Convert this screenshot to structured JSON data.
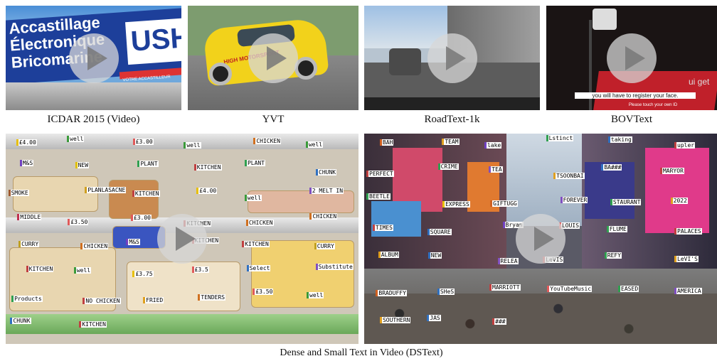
{
  "captions": {
    "icdar": "ICDAR 2015 (Video)",
    "yvt": "YVT",
    "roadtext": "RoadText-1k",
    "bovtext": "BOVText",
    "dstext": "Dense and Small Text in Video (DSText)"
  },
  "icdar_scene": {
    "sign_text": "Accastillage\nÉlectronique\nBricomarine",
    "brand": "USHI",
    "banner": "VOTRE ACCASTILLEUR QUOTIDIEN"
  },
  "yvt_scene": {
    "decal": "HIGH MOTORSPORT"
  },
  "bovtext_scene": {
    "screen_text": "you will have to register your face.",
    "screen_subtext": "Please touch your own ID",
    "light_text": "ui get"
  },
  "supermarket_labels": [
    {
      "t": "£4.00",
      "c": "#e8c000"
    },
    {
      "t": "well",
      "c": "#3a9a3a"
    },
    {
      "t": "£3.00",
      "c": "#e05a5a"
    },
    {
      "t": "well",
      "c": "#3a9a3a"
    },
    {
      "t": "CHICKEN",
      "c": "#d07020"
    },
    {
      "t": "well",
      "c": "#3a9a3a"
    },
    {
      "t": "M&S",
      "c": "#7040c0"
    },
    {
      "t": "NEW",
      "c": "#e0c000"
    },
    {
      "t": "PLANT",
      "c": "#30a050"
    },
    {
      "t": "KITCHEN",
      "c": "#c04040"
    },
    {
      "t": "PLANT",
      "c": "#30a050"
    },
    {
      "t": "CHUNK",
      "c": "#3070c0"
    },
    {
      "t": "SMOKE",
      "c": "#a05a30"
    },
    {
      "t": "PLANLASACNE",
      "c": "#d0a020"
    },
    {
      "t": "KITCHEN",
      "c": "#c04040"
    },
    {
      "t": "£4.00",
      "c": "#e8c000"
    },
    {
      "t": "well",
      "c": "#3a9a3a"
    },
    {
      "t": "2 MELT IN",
      "c": "#8050c0"
    },
    {
      "t": "MIDDLE",
      "c": "#c03050"
    },
    {
      "t": "£3.50",
      "c": "#e05a5a"
    },
    {
      "t": "£3.00",
      "c": "#e05a5a"
    },
    {
      "t": "KITCHEN",
      "c": "#c04040"
    },
    {
      "t": "CHICKEN",
      "c": "#d07020"
    },
    {
      "t": "CHICKEN",
      "c": "#d07020"
    },
    {
      "t": "CURRY",
      "c": "#c0a020"
    },
    {
      "t": "CHICKEN",
      "c": "#d07020"
    },
    {
      "t": "M&S",
      "c": "#7040c0"
    },
    {
      "t": "KITCHEN",
      "c": "#c04040"
    },
    {
      "t": "KITCHEN",
      "c": "#c04040"
    },
    {
      "t": "CURRY",
      "c": "#c0a020"
    },
    {
      "t": "KITCHEN",
      "c": "#c04040"
    },
    {
      "t": "well",
      "c": "#3a9a3a"
    },
    {
      "t": "£3.75",
      "c": "#e8c000"
    },
    {
      "t": "£3.5",
      "c": "#e05a5a"
    },
    {
      "t": "Select",
      "c": "#3070c0"
    },
    {
      "t": "Substitute",
      "c": "#8050c0"
    },
    {
      "t": "Products",
      "c": "#30a050"
    },
    {
      "t": "NO CHICKEN",
      "c": "#c04040"
    },
    {
      "t": "FRIED",
      "c": "#e0a020"
    },
    {
      "t": "TENDERS",
      "c": "#d07020"
    },
    {
      "t": "£3.50",
      "c": "#e05a5a"
    },
    {
      "t": "well",
      "c": "#3a9a3a"
    },
    {
      "t": "CHUNK",
      "c": "#3070c0"
    },
    {
      "t": "KITCHEN",
      "c": "#c04040"
    }
  ],
  "timessquare_labels": [
    {
      "t": "BAH",
      "c": "#d06020"
    },
    {
      "t": "TEAM",
      "c": "#e0a020"
    },
    {
      "t": "lake",
      "c": "#7040c0"
    },
    {
      "t": "Lstinct",
      "c": "#30a050"
    },
    {
      "t": "taking",
      "c": "#3070c0"
    },
    {
      "t": "upler",
      "c": "#c04040"
    },
    {
      "t": "PERFECT",
      "c": "#c04040"
    },
    {
      "t": "CRIME",
      "c": "#30a050"
    },
    {
      "t": "TEA",
      "c": "#8050c0"
    },
    {
      "t": "TSOONBAI",
      "c": "#e0a020"
    },
    {
      "t": "BA###",
      "c": "#3070c0"
    },
    {
      "t": "MARYOR",
      "c": "#c04040"
    },
    {
      "t": "BEETLE",
      "c": "#30a050"
    },
    {
      "t": "EXPRESS",
      "c": "#e8c000"
    },
    {
      "t": "GIFTUGG",
      "c": "#d06020"
    },
    {
      "t": "FOREVER",
      "c": "#8050c0"
    },
    {
      "t": "STAURANT",
      "c": "#30a050"
    },
    {
      "t": "2022",
      "c": "#e0a020"
    },
    {
      "t": "TIMES",
      "c": "#c04040"
    },
    {
      "t": "SQUARE",
      "c": "#3070c0"
    },
    {
      "t": "Bryan",
      "c": "#7040c0"
    },
    {
      "t": "LOUIS",
      "c": "#e05a5a"
    },
    {
      "t": "FLUME",
      "c": "#30a050"
    },
    {
      "t": "PALACES",
      "c": "#c04040"
    },
    {
      "t": "ALBUM",
      "c": "#e0a020"
    },
    {
      "t": "NEW",
      "c": "#3070c0"
    },
    {
      "t": "RELEA",
      "c": "#8050c0"
    },
    {
      "t": "LeVIS",
      "c": "#c04040"
    },
    {
      "t": "REFY",
      "c": "#30a050"
    },
    {
      "t": "LeVI'S",
      "c": "#e0a020"
    },
    {
      "t": "BRADUFFY",
      "c": "#d06020"
    },
    {
      "t": "SHeS",
      "c": "#3070c0"
    },
    {
      "t": "MARRIOTT",
      "c": "#c04040"
    },
    {
      "t": "YouTubeMusic",
      "c": "#e05a5a"
    },
    {
      "t": "EASED",
      "c": "#30a050"
    },
    {
      "t": "AMERICA",
      "c": "#8050c0"
    },
    {
      "t": "SOUTHERN",
      "c": "#e0a020"
    },
    {
      "t": "JAS",
      "c": "#3070c0"
    },
    {
      "t": "###",
      "c": "#c04040"
    }
  ]
}
